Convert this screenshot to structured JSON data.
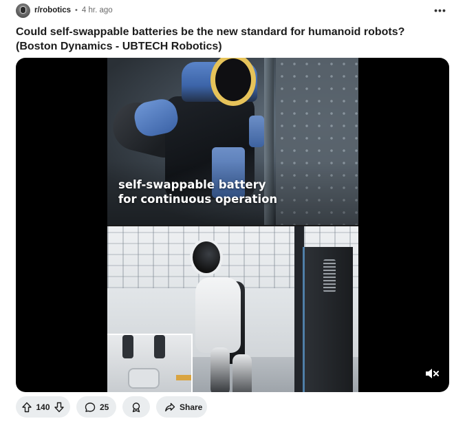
{
  "post": {
    "subreddit": "r/robotics",
    "separator": "•",
    "timestamp": "4 hr. ago",
    "more_label": "•••",
    "title": "Could self-swappable batteries be the new standard for humanoid robots? (Boston Dynamics - UBTECH Robotics)"
  },
  "media": {
    "caption_line_1": "self-swappable battery",
    "caption_line_2": "for continuous operation",
    "mute_icon": "speaker-muted-icon"
  },
  "actions": {
    "vote_count": "140",
    "comment_count": "25",
    "share_label": "Share",
    "upvote_icon": "upvote-arrow-icon",
    "downvote_icon": "downvote-arrow-icon",
    "comment_icon": "comment-bubble-icon",
    "award_icon": "award-icon",
    "share_icon": "share-arrow-icon"
  },
  "colors": {
    "pill_background": "#eaedef",
    "text": "#1c1c1c",
    "muted_text": "#6a6a6a",
    "media_background": "#000000"
  }
}
